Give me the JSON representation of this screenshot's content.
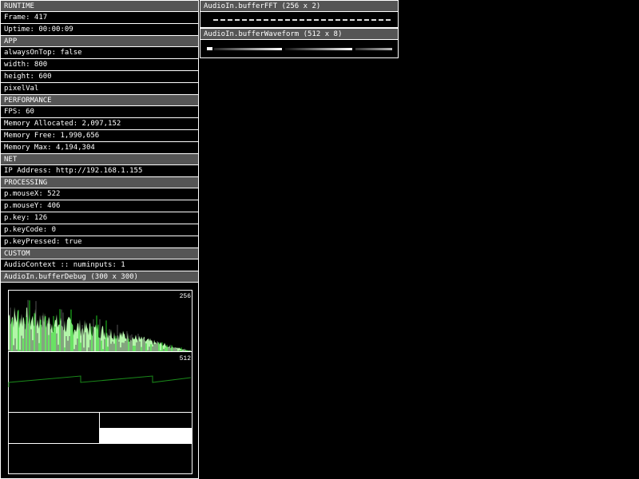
{
  "runtime": {
    "header": "RUNTIME",
    "frame": "Frame: 417",
    "uptime": "Uptime: 00:00:09"
  },
  "app": {
    "header": "APP",
    "always_on_top": "alwaysOnTop: false",
    "width": "width: 800",
    "height": "height: 600",
    "pixel_val": "pixelVal"
  },
  "performance": {
    "header": "PERFORMANCE",
    "fps": "FPS: 60",
    "mem_alloc": "Memory Allocated: 2,097,152",
    "mem_free": "Memory Free: 1,990,656",
    "mem_max": "Memory Max: 4,194,304"
  },
  "net": {
    "header": "NET",
    "ip": "IP Address: http://192.168.1.155"
  },
  "processing": {
    "header": "PROCESSING",
    "mouse_x": "p.mouseX: 522",
    "mouse_y": "p.mouseY: 406",
    "key": "p.key: 126",
    "key_code": "p.keyCode: 0",
    "key_pressed": "p.keyPressed: true"
  },
  "custom": {
    "header": "CUSTOM",
    "audio_ctx": "AudioContext :: numinputs: 1",
    "buffer_debug": "AudioIn.bufferDebug (300 x 300)"
  },
  "fft": {
    "header": "AudioIn.bufferFFT (256 x 2)"
  },
  "waveform": {
    "header": "AudioIn.bufferWaveform (512 x 8)"
  },
  "debug": {
    "fft_label": "256",
    "wave_label": "512"
  },
  "colors": {
    "header_bg": "#555555",
    "spectrum_fill": "#b3f5a9",
    "spectrum_bar": "#1fcf1f",
    "wave_line": "#1a8a1a",
    "border": "#ffffff"
  }
}
